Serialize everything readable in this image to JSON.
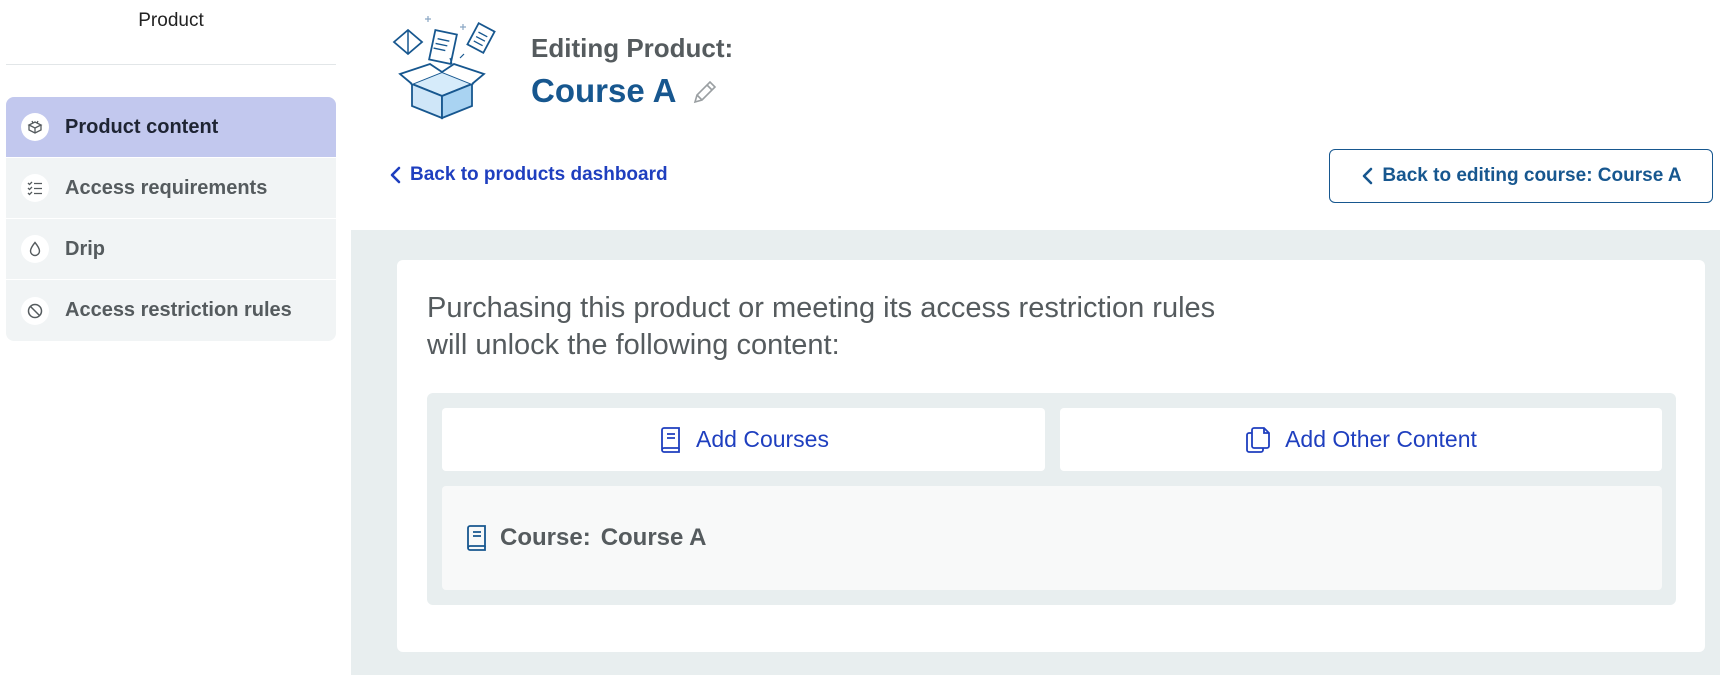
{
  "sidebar": {
    "title": "Product",
    "items": [
      {
        "label": "Product content",
        "icon": "box-open-icon",
        "active": true
      },
      {
        "label": "Access requirements",
        "icon": "checklist-icon",
        "active": false
      },
      {
        "label": "Drip",
        "icon": "drop-icon",
        "active": false
      },
      {
        "label": "Access restriction rules",
        "icon": "ban-icon",
        "active": false
      }
    ]
  },
  "header": {
    "editing_label": "Editing Product:",
    "product_name": "Course A",
    "back_link": "Back to products dashboard",
    "back_course_button": "Back to editing course: Course A"
  },
  "main": {
    "intro_line1": "Purchasing this product or meeting its access restriction rules",
    "intro_line2": "will unlock the following content:",
    "add_courses_label": "Add Courses",
    "add_other_label": "Add Other Content",
    "course_prefix": "Course:",
    "course_name": "Course A"
  },
  "colors": {
    "accent_blue": "#1f3fbf",
    "brand_blue": "#17578f",
    "active_menu": "#c2c8ee",
    "panel_bg": "#e8eeef"
  }
}
